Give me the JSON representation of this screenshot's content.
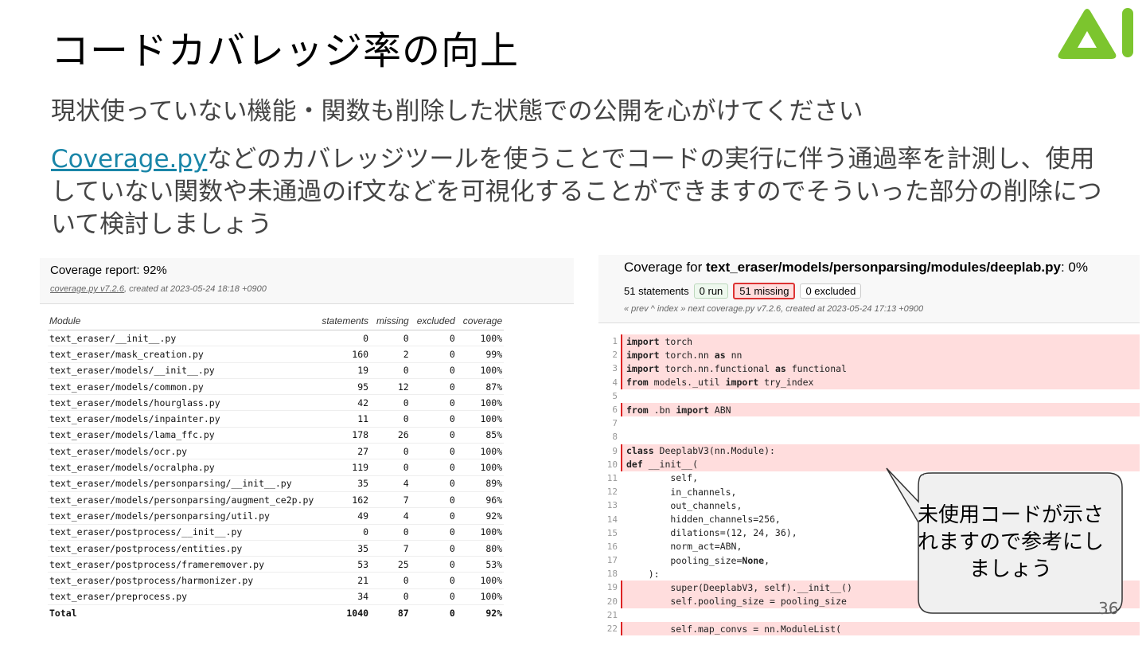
{
  "slide": {
    "title": "コードカバレッジ率の向上",
    "subtitle": "現状使っていない機能・関数も削除した状態での公開を心がけてください",
    "paragraph_link": "Coverage.py",
    "paragraph_rest": "などのカバレッジツールを使うことでコードの実行に伴う通過率を計測し、使用していない関数や未通過のif文などを可視化することができますのでそういった部分の削除について検討しましょう",
    "callout": "未使用コードが示されますので参考にしましょう",
    "page_number": "36",
    "logo_color": "#7cc52e"
  },
  "report": {
    "title": "Coverage report: 92%",
    "meta_link": "coverage.py v7.2.6",
    "meta_rest": ", created at 2023-05-24 18:18 +0900",
    "columns": [
      "Module",
      "statements",
      "missing",
      "excluded",
      "coverage"
    ],
    "rows": [
      [
        "text_eraser/__init__.py",
        "0",
        "0",
        "0",
        "100%"
      ],
      [
        "text_eraser/mask_creation.py",
        "160",
        "2",
        "0",
        "99%"
      ],
      [
        "text_eraser/models/__init__.py",
        "19",
        "0",
        "0",
        "100%"
      ],
      [
        "text_eraser/models/common.py",
        "95",
        "12",
        "0",
        "87%"
      ],
      [
        "text_eraser/models/hourglass.py",
        "42",
        "0",
        "0",
        "100%"
      ],
      [
        "text_eraser/models/inpainter.py",
        "11",
        "0",
        "0",
        "100%"
      ],
      [
        "text_eraser/models/lama_ffc.py",
        "178",
        "26",
        "0",
        "85%"
      ],
      [
        "text_eraser/models/ocr.py",
        "27",
        "0",
        "0",
        "100%"
      ],
      [
        "text_eraser/models/ocralpha.py",
        "119",
        "0",
        "0",
        "100%"
      ],
      [
        "text_eraser/models/personparsing/__init__.py",
        "35",
        "4",
        "0",
        "89%"
      ],
      [
        "text_eraser/models/personparsing/augment_ce2p.py",
        "162",
        "7",
        "0",
        "96%"
      ],
      [
        "text_eraser/models/personparsing/util.py",
        "49",
        "4",
        "0",
        "92%"
      ],
      [
        "text_eraser/postprocess/__init__.py",
        "0",
        "0",
        "0",
        "100%"
      ],
      [
        "text_eraser/postprocess/entities.py",
        "35",
        "7",
        "0",
        "80%"
      ],
      [
        "text_eraser/postprocess/frameremover.py",
        "53",
        "25",
        "0",
        "53%"
      ],
      [
        "text_eraser/postprocess/harmonizer.py",
        "21",
        "0",
        "0",
        "100%"
      ],
      [
        "text_eraser/preprocess.py",
        "34",
        "0",
        "0",
        "100%"
      ]
    ],
    "total": [
      "Total",
      "1040",
      "87",
      "0",
      "92%"
    ]
  },
  "source": {
    "title_prefix": "Coverage for ",
    "title_file": "text_eraser/models/personparsing/modules/deeplab.py",
    "title_suffix": ": 0%",
    "statements": "51 statements",
    "run": "0 run",
    "missing": "51 missing",
    "excluded": "0 excluded",
    "nav": "« prev     ^ index     » next       coverage.py v7.2.6, created at 2023-05-24 17:13 +0900",
    "lines": [
      {
        "n": "1",
        "m": true,
        "code": "<b>import</b> torch"
      },
      {
        "n": "2",
        "m": true,
        "code": "<b>import</b> torch.nn <b>as</b> nn"
      },
      {
        "n": "3",
        "m": true,
        "code": "<b>import</b> torch.nn.functional <b>as</b> functional"
      },
      {
        "n": "4",
        "m": true,
        "code": "<b>from</b> models._util <b>import</b> try_index"
      },
      {
        "n": "5",
        "m": false,
        "code": ""
      },
      {
        "n": "6",
        "m": true,
        "code": "<b>from</b> .bn <b>import</b> ABN"
      },
      {
        "n": "7",
        "m": false,
        "code": ""
      },
      {
        "n": "8",
        "m": false,
        "code": ""
      },
      {
        "n": "9",
        "m": true,
        "code": "<b>class</b> DeeplabV3(nn.Module):"
      },
      {
        "n": "10",
        "m": true,
        "code": "    <b>def</b> __init__("
      },
      {
        "n": "11",
        "m": false,
        "code": "        self,"
      },
      {
        "n": "12",
        "m": false,
        "code": "        in_channels,"
      },
      {
        "n": "13",
        "m": false,
        "code": "        out_channels,"
      },
      {
        "n": "14",
        "m": false,
        "code": "        hidden_channels=256,"
      },
      {
        "n": "15",
        "m": false,
        "code": "        dilations=(12, 24, 36),"
      },
      {
        "n": "16",
        "m": false,
        "code": "        norm_act=ABN,"
      },
      {
        "n": "17",
        "m": false,
        "code": "        pooling_size=<b>None</b>,"
      },
      {
        "n": "18",
        "m": false,
        "code": "    ):"
      },
      {
        "n": "19",
        "m": true,
        "code": "        super(DeeplabV3, self).__init__()"
      },
      {
        "n": "20",
        "m": true,
        "code": "        self.pooling_size = pooling_size"
      },
      {
        "n": "21",
        "m": false,
        "code": ""
      },
      {
        "n": "22",
        "m": true,
        "code": "        self.map_convs = nn.ModuleList("
      }
    ]
  }
}
